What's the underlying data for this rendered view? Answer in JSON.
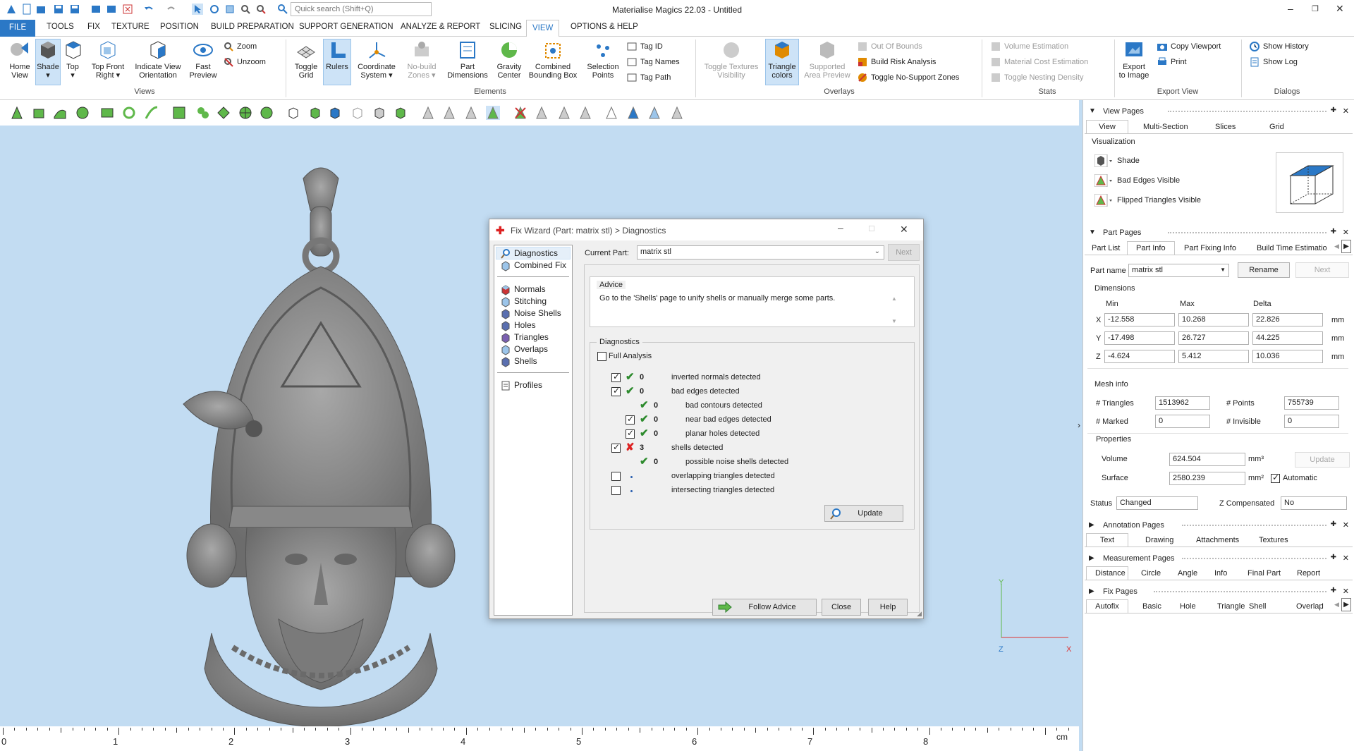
{
  "title_bar": {
    "app_title": "Materialise Magics 22.03 - Untitled",
    "search_placeholder": "Quick search (Shift+Q)"
  },
  "tabs": [
    "FILE",
    "TOOLS",
    "FIX",
    "TEXTURE",
    "POSITION",
    "BUILD PREPARATION",
    "SUPPORT GENERATION",
    "ANALYZE & REPORT",
    "SLICING",
    "VIEW",
    "OPTIONS & HELP"
  ],
  "ribbon": {
    "views": {
      "home": [
        "Home",
        "View"
      ],
      "shade": "Shade",
      "top": "Top",
      "tfr": [
        "Top Front",
        "Right"
      ],
      "ivo": [
        "Indicate View",
        "Orientation"
      ],
      "fast": [
        "Fast",
        "Preview"
      ],
      "zoom": "Zoom",
      "unzoom": "Unzoom",
      "group": "Views"
    },
    "elements": {
      "grid": [
        "Toggle",
        "Grid"
      ],
      "rulers": "Rulers",
      "coord": [
        "Coordinate",
        "System"
      ],
      "nobuild": [
        "No-build",
        "Zones"
      ],
      "partdim": [
        "Part",
        "Dimensions"
      ],
      "gravity": [
        "Gravity",
        "Center"
      ],
      "combined": [
        "Combined",
        "Bounding Box"
      ],
      "selection": [
        "Selection",
        "Points"
      ],
      "tagid": "Tag ID",
      "tagnames": "Tag Names",
      "tagpath": "Tag Path",
      "group": "Elements"
    },
    "overlays": {
      "textures": [
        "Toggle Textures",
        "Visibility"
      ],
      "triangle": [
        "Triangle",
        "colors"
      ],
      "supported": [
        "Supported",
        "Area Preview"
      ],
      "oob": "Out Of Bounds",
      "buildrisk": "Build Risk Analysis",
      "nosupport": "Toggle No-Support Zones",
      "group": "Overlays"
    },
    "stats": {
      "volume": "Volume Estimation",
      "material": "Material Cost Estimation",
      "nesting": "Toggle Nesting Density",
      "group": "Stats"
    },
    "export": {
      "export_image": [
        "Export",
        "to Image"
      ],
      "copy": "Copy Viewport",
      "print": "Print",
      "group": "Export View"
    },
    "dialogs": {
      "history": "Show History",
      "log": "Show Log",
      "group": "Dialogs"
    }
  },
  "ruler": {
    "labels": [
      "0",
      "1",
      "2",
      "3",
      "4",
      "5",
      "6",
      "7",
      "8"
    ],
    "unit": "cm"
  },
  "axes": {
    "x": "X",
    "y": "Y",
    "z": "Z"
  },
  "panel": {
    "view_pages": {
      "title": "View Pages",
      "tabs": [
        "View",
        "Multi-Section",
        "Slices",
        "Grid"
      ],
      "visualization": "Visualization",
      "shade": "Shade",
      "bad_edges": "Bad Edges Visible",
      "flipped": "Flipped Triangles Visible"
    },
    "part_pages": {
      "title": "Part Pages",
      "tabs": [
        "Part List",
        "Part Info",
        "Part Fixing Info",
        "Build Time Estimatio"
      ],
      "part_name_label": "Part name",
      "part_name": "matrix stl",
      "rename": "Rename",
      "next": "Next",
      "dimensions": "Dimensions",
      "cols": [
        "Min",
        "Max",
        "Delta"
      ],
      "unit": "mm",
      "rows": [
        {
          "axis": "X",
          "min": "-12.558",
          "max": "10.268",
          "delta": "22.826"
        },
        {
          "axis": "Y",
          "min": "-17.498",
          "max": "26.727",
          "delta": "44.225"
        },
        {
          "axis": "Z",
          "min": "-4.624",
          "max": "5.412",
          "delta": "10.036"
        }
      ],
      "mesh_info": "Mesh info",
      "triangles_label": "# Triangles",
      "triangles": "1513962",
      "points_label": "# Points",
      "points": "755739",
      "marked_label": "# Marked",
      "marked": "0",
      "invisible_label": "# Invisible",
      "invisible": "0",
      "properties": "Properties",
      "volume_label": "Volume",
      "volume": "624.504",
      "volume_unit": "mm³",
      "update": "Update",
      "surface_label": "Surface",
      "surface": "2580.239",
      "surface_unit": "mm²",
      "automatic": "Automatic",
      "status_label": "Status",
      "status": "Changed",
      "zcomp_label": "Z Compensated",
      "zcomp": "No"
    },
    "annotation_pages": {
      "title": "Annotation Pages",
      "tabs": [
        "Text",
        "Drawing",
        "Attachments",
        "Textures"
      ]
    },
    "measurement_pages": {
      "title": "Measurement Pages",
      "tabs": [
        "Distance",
        "Circle",
        "Angle",
        "Info",
        "Final Part",
        "Report"
      ]
    },
    "fix_pages": {
      "title": "Fix Pages",
      "tabs": [
        "Autofix",
        "Basic",
        "Hole",
        "Triangle",
        "Shell",
        "Overlap",
        "I"
      ]
    }
  },
  "dialog": {
    "title": "Fix Wizard (Part: matrix stl) > Diagnostics",
    "nav": [
      "Diagnostics",
      "Combined Fix",
      "Normals",
      "Stitching",
      "Noise Shells",
      "Holes",
      "Triangles",
      "Overlaps",
      "Shells",
      "Profiles"
    ],
    "current_part_label": "Current Part:",
    "current_part": "matrix stl",
    "next": "Next",
    "advice_label": "Advice",
    "advice_text": "Go to the 'Shells' page to unify shells or manually merge some parts.",
    "diagnostics_label": "Diagnostics",
    "full_analysis": "Full Analysis",
    "rows": [
      {
        "count": "0",
        "text": "inverted normals detected"
      },
      {
        "count": "0",
        "text": "bad edges detected"
      },
      {
        "count": "0",
        "text": "bad contours detected"
      },
      {
        "count": "0",
        "text": "near bad edges detected"
      },
      {
        "count": "0",
        "text": "planar holes detected"
      },
      {
        "count": "3",
        "text": "shells detected"
      },
      {
        "count": "0",
        "text": "possible noise shells detected"
      },
      {
        "count": "",
        "text": "overlapping triangles detected"
      },
      {
        "count": "",
        "text": "intersecting triangles detected"
      }
    ],
    "update": "Update",
    "follow_advice": "Follow Advice",
    "close": "Close",
    "help": "Help"
  }
}
